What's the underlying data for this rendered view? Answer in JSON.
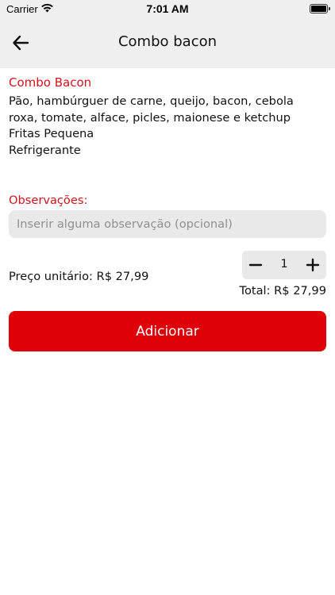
{
  "status_bar": {
    "carrier": "Carrier",
    "time": "7:01 AM"
  },
  "nav": {
    "title": "Combo bacon",
    "back_icon": "arrow-left-icon"
  },
  "product": {
    "name": "Combo Bacon",
    "description_lines": [
      "Pão, hambúrguer de carne, queijo, bacon, cebola",
      "roxa, tomate, alface, picles, maionese e ketchup",
      "Fritas Pequena",
      "Refrigerante"
    ]
  },
  "observations": {
    "label": "Observações:",
    "placeholder": "Inserir alguma observação (opcional)",
    "value": ""
  },
  "pricing": {
    "unit_price_label": "Preço unitário: R$ 27,99",
    "quantity": "1",
    "total_label": "Total: R$ 27,99"
  },
  "actions": {
    "add_label": "Adicionar"
  },
  "colors": {
    "accent": "#de0108",
    "accent_text": "#d0121b",
    "header_bg": "#efefef",
    "field_bg": "#e9e9e9"
  }
}
